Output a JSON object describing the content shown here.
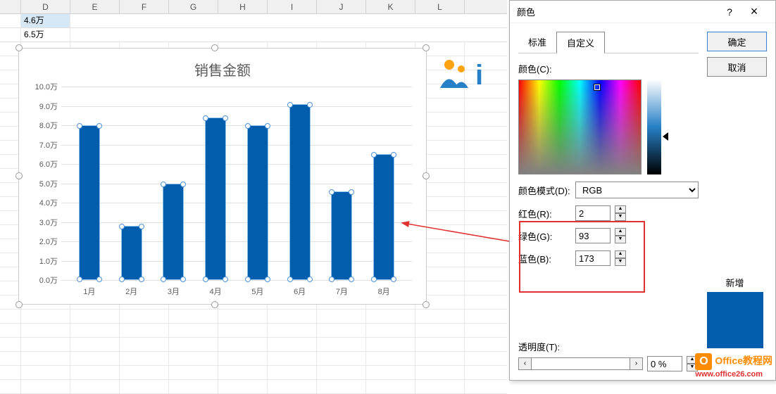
{
  "spreadsheet": {
    "columns": [
      "D",
      "E",
      "F",
      "G",
      "H",
      "I",
      "J",
      "K",
      "L"
    ],
    "cells": {
      "d1": "4.6万",
      "d2": "6.5万"
    }
  },
  "chart_data": {
    "type": "bar",
    "title": "销售金额",
    "categories": [
      "1月",
      "2月",
      "3月",
      "4月",
      "5月",
      "6月",
      "7月",
      "8月"
    ],
    "values": [
      8.0,
      2.8,
      5.0,
      8.4,
      8.0,
      9.1,
      4.6,
      6.5
    ],
    "ylabel": "",
    "ylim": [
      0,
      10
    ],
    "y_ticks": [
      "0.0万",
      "1.0万",
      "2.0万",
      "3.0万",
      "4.0万",
      "5.0万",
      "6.0万",
      "7.0万",
      "8.0万",
      "9.0万",
      "10.0万"
    ]
  },
  "dialog": {
    "title": "颜色",
    "help": "?",
    "close": "×",
    "ok": "确定",
    "cancel": "取消",
    "tab_standard": "标准",
    "tab_custom": "自定义",
    "color_label": "颜色(C):",
    "mode_label": "颜色模式(D):",
    "mode_value": "RGB",
    "red_label": "红色(R):",
    "red_value": "2",
    "green_label": "绿色(G):",
    "green_value": "93",
    "blue_label": "蓝色(B):",
    "blue_value": "173",
    "trans_label": "透明度(T):",
    "trans_value": "0 %",
    "new_label": "新增"
  },
  "watermark": {
    "line1": "Office教程网",
    "line2": "www.office26.com"
  }
}
